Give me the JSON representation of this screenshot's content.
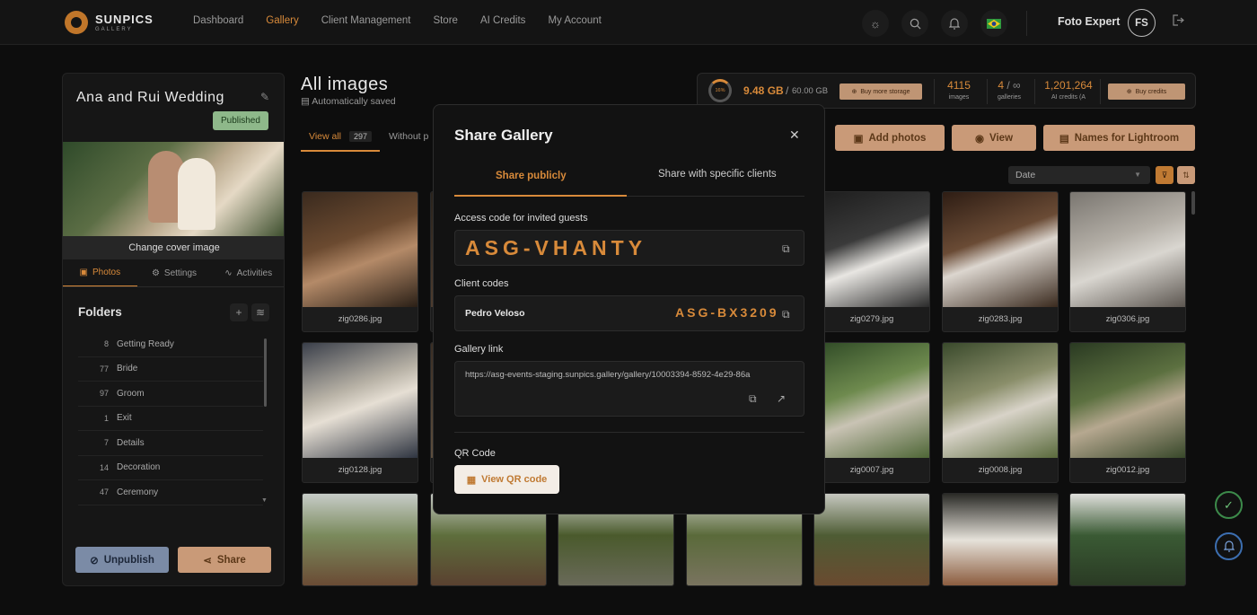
{
  "brand": {
    "name": "SUNPICS",
    "sub": "GALLERY"
  },
  "nav": [
    "Dashboard",
    "Gallery",
    "Client Management",
    "Store",
    "AI Credits",
    "My Account"
  ],
  "nav_active": "Gallery",
  "user": {
    "name": "Foto Expert",
    "initials": "FS"
  },
  "gallery": {
    "title": "Ana and Rui Wedding",
    "status": "Published",
    "change_cover": "Change cover image",
    "tabs": [
      "Photos",
      "Settings",
      "Activities"
    ],
    "folders_title": "Folders",
    "folders": [
      {
        "count": "8",
        "name": "Getting Ready"
      },
      {
        "count": "77",
        "name": "Bride"
      },
      {
        "count": "97",
        "name": "Groom"
      },
      {
        "count": "1",
        "name": "Exit"
      },
      {
        "count": "7",
        "name": "Details"
      },
      {
        "count": "14",
        "name": "Decoration"
      },
      {
        "count": "47",
        "name": "Ceremony"
      }
    ],
    "unpublish_label": "Unpublish",
    "share_label": "Share"
  },
  "main": {
    "title": "All images",
    "autosave": "Automatically saved",
    "view_all": "View all",
    "view_all_count": "297",
    "without": "Without p"
  },
  "storage": {
    "percent": "16%",
    "used": "9.48 GB",
    "separator": "/",
    "total": "60.00 GB",
    "buy_storage": "Buy more storage",
    "images_count": "4115",
    "images_label": "images",
    "galleries_count": "4",
    "galleries_of": "/ ∞",
    "galleries_label": "galleries",
    "credits_count": "1,201,264",
    "credits_label": "AI credits (A",
    "buy_credits": "Buy credits"
  },
  "actions": {
    "add_photos": "Add photos",
    "view": "View",
    "names_lightroom": "Names for Lightroom"
  },
  "sort": {
    "value": "Date"
  },
  "photos": [
    {
      "name": "zig0286.jpg",
      "color": "linear-gradient(160deg,#3a2a1e,#6b4a30 40%,#b48a68 60%,#2a1f16)"
    },
    {
      "name": "",
      "color": "linear-gradient(160deg,#2a231c,#5a4636)"
    },
    {
      "name": "",
      "color": "linear-gradient(160deg,#2a231c,#4a3a2c)"
    },
    {
      "name": "",
      "color": "linear-gradient(160deg,#2a231c,#4a3a2c)"
    },
    {
      "name": "zig0279.jpg",
      "color": "linear-gradient(160deg,#1d1d1d,#3a3a3a 40%,#e8e6e2 60%,#2a2a2a)"
    },
    {
      "name": "zig0283.jpg",
      "color": "linear-gradient(160deg,#2e1d14,#6a4b35 40%,#dcd6cf 55%,#3a2a1e)"
    },
    {
      "name": "zig0306.jpg",
      "color": "linear-gradient(160deg,#7a7670,#b3aea6 40%,#d9d6d0 60%,#5c5650)"
    },
    {
      "name": "zig0128.jpg",
      "color": "linear-gradient(160deg,#3a3f4a,#b8b2a6 40%,#e6dfd4 55%,#2e3440)"
    },
    {
      "name": "",
      "color": "linear-gradient(160deg,#3a2e24,#6a5a48)"
    },
    {
      "name": "",
      "color": "linear-gradient(160deg,#2e3a28,#55663e)"
    },
    {
      "name": "",
      "color": "linear-gradient(160deg,#2e3a28,#55663e)"
    },
    {
      "name": "zig0007.jpg",
      "color": "linear-gradient(160deg,#2f4a26,#6e8a4e 40%,#c9c3b4 60%,#4e6636)"
    },
    {
      "name": "zig0008.jpg",
      "color": "linear-gradient(160deg,#3a4a2c,#8a8e6a 40%,#d8d3c8 60%,#5a6a3c)"
    },
    {
      "name": "zig0012.jpg",
      "color": "linear-gradient(160deg,#2a3a22,#5c7040 40%,#b6a890 60%,#38482a)"
    },
    {
      "name": "",
      "color": "linear-gradient(180deg,#c7ccc8,#7a8a5c 45%,#6a4a34 100%)"
    },
    {
      "name": "",
      "color": "linear-gradient(180deg,#c4c8c2,#5e6e3c 45%,#5a4030 100%)"
    },
    {
      "name": "",
      "color": "linear-gradient(180deg,#cfd2cc,#4a5a2c 45%,#6a6a5a 100%)"
    },
    {
      "name": "",
      "color": "linear-gradient(180deg,#cfd0c8,#5a6a3a 45%,#7a7460 100%)"
    },
    {
      "name": "",
      "color": "linear-gradient(180deg,#c6c8c0,#4e5c34 45%,#6a4a30 100%)"
    },
    {
      "name": "",
      "color": "linear-gradient(180deg,#2a2a26,#e6e2da 50%,#8a5a3c 100%)"
    },
    {
      "name": "",
      "color": "linear-gradient(180deg,#e0e0dc,#3a5a34 45%,#2a3a24 100%)"
    }
  ],
  "modal": {
    "title": "Share Gallery",
    "tab_public": "Share publicly",
    "tab_clients": "Share with specific clients",
    "access_label": "Access code for invited guests",
    "access_code": "ASG-VHANTY",
    "client_codes_label": "Client codes",
    "client_name": "Pedro Veloso",
    "client_code": "ASG-BX3209",
    "gallery_link_label": "Gallery link",
    "gallery_link": "https://asg-events-staging.sunpics.gallery/gallery/10003394-8592-4e29-86a",
    "qr_label": "QR Code",
    "qr_button": "View QR code"
  }
}
